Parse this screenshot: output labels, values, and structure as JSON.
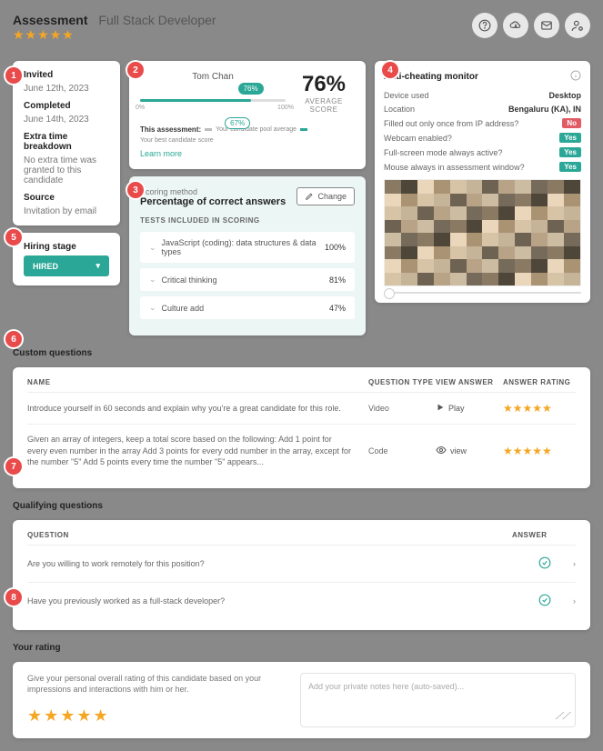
{
  "header": {
    "assessment_label": "Assessment",
    "role": "Full Stack Developer"
  },
  "col1": {
    "invited_label": "Invited",
    "invited_value": "June 12th, 2023",
    "completed_label": "Completed",
    "completed_value": "June 14th, 2023",
    "extra_label": "Extra time breakdown",
    "extra_value": "No extra time was granted to this candidate",
    "source_label": "Source",
    "source_value": "Invitation by email",
    "stage_label": "Hiring stage",
    "stage_value": "HIRED"
  },
  "score": {
    "name": "Tom Chan",
    "candidate_pct": "76%",
    "pool_pct": "67%",
    "tick0": "0%",
    "tick100": "100%",
    "big": "76%",
    "big_label": "AVERAGE SCORE",
    "legend_title": "This assessment:",
    "legend1": "Your candidate pool average",
    "legend2": "Your best candidate score",
    "learn_more": "Learn more"
  },
  "scoring": {
    "lbl": "Scoring method",
    "ttl": "Percentage of correct answers",
    "change": "Change",
    "tests_label": "TESTS INCLUDED IN SCORING",
    "tests": [
      {
        "name": "JavaScript (coding): data structures & data types",
        "pct": "100%"
      },
      {
        "name": "Critical thinking",
        "pct": "81%"
      },
      {
        "name": "Culture add",
        "pct": "47%"
      }
    ]
  },
  "anti": {
    "title": "Anti-cheating monitor",
    "rows": [
      {
        "label": "Device used",
        "value": "Desktop",
        "type": "text"
      },
      {
        "label": "Location",
        "value": "Bengaluru (KA), IN",
        "type": "text"
      },
      {
        "label": "Filled out only once from IP address?",
        "value": "No",
        "type": "no"
      },
      {
        "label": "Webcam enabled?",
        "value": "Yes",
        "type": "yes"
      },
      {
        "label": "Full-screen mode always active?",
        "value": "Yes",
        "type": "yes"
      },
      {
        "label": "Mouse always in assessment window?",
        "value": "Yes",
        "type": "yes"
      }
    ]
  },
  "custom": {
    "heading": "Custom questions",
    "cols": {
      "name": "NAME",
      "type": "QUESTION TYPE",
      "view": "VIEW ANSWER",
      "rating": "ANSWER RATING"
    },
    "rows": [
      {
        "name": "Introduce yourself in 60 seconds and explain why you're a great candidate for this role.",
        "type": "Video",
        "view": "Play",
        "icon": "play"
      },
      {
        "name": "Given an array of integers, keep a total score based on the following: Add 1 point for every even number in the array Add 3 points for every odd number in the array, except for the number \"5\" Add 5 points every time the number \"5\" appears...",
        "type": "Code",
        "view": "view",
        "icon": "eye"
      }
    ]
  },
  "qq": {
    "heading": "Qualifying questions",
    "cols": {
      "q": "QUESTION",
      "a": "ANSWER"
    },
    "rows": [
      "Are you willing to work remotely for this position?",
      "Have you previously worked as a full-stack developer?"
    ]
  },
  "rating": {
    "heading": "Your rating",
    "desc": "Give your personal overall rating of this candidate based on your impressions and interactions with him or her.",
    "notes_placeholder": "Add your private notes here (auto-saved)..."
  },
  "chart_data": {
    "type": "bar",
    "title": "Tom Chan",
    "categories": [
      "candidate_score",
      "pool_average"
    ],
    "values": [
      76,
      67
    ],
    "xlabel": "",
    "ylabel": "",
    "ylim": [
      0,
      100
    ]
  }
}
